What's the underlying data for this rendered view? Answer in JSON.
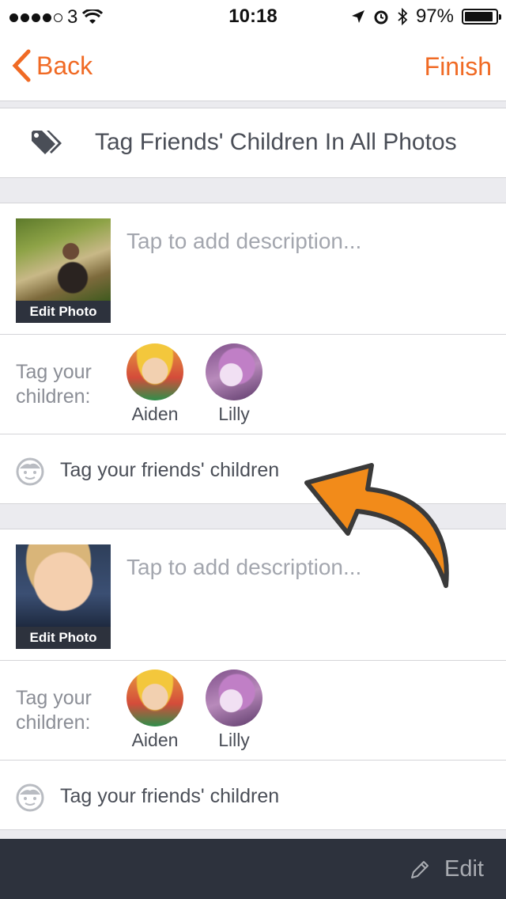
{
  "status_bar": {
    "carrier": "3",
    "time": "10:18",
    "battery": "97%",
    "battery_level": 0.97
  },
  "nav": {
    "back_label": "Back",
    "finish_label": "Finish"
  },
  "tag_all": {
    "label": "Tag Friends' Children In All Photos",
    "icon": "tag-icon"
  },
  "photos": [
    {
      "edit_label": "Edit Photo",
      "description_placeholder": "Tap to add description...",
      "tag_children_label": "Tag your children:",
      "children": [
        {
          "name": "Aiden"
        },
        {
          "name": "Lilly"
        }
      ],
      "friends_label": "Tag your friends' children"
    },
    {
      "edit_label": "Edit Photo",
      "description_placeholder": "Tap to add description...",
      "tag_children_label": "Tag your children:",
      "children": [
        {
          "name": "Aiden"
        },
        {
          "name": "Lilly"
        }
      ],
      "friends_label": "Tag your friends' children"
    }
  ],
  "toolbar": {
    "edit_label": "Edit",
    "icon": "pencil-icon"
  },
  "colors": {
    "accent": "#f06a24",
    "toolbar_bg": "#2d323d",
    "arrow": "#f28b1a"
  }
}
